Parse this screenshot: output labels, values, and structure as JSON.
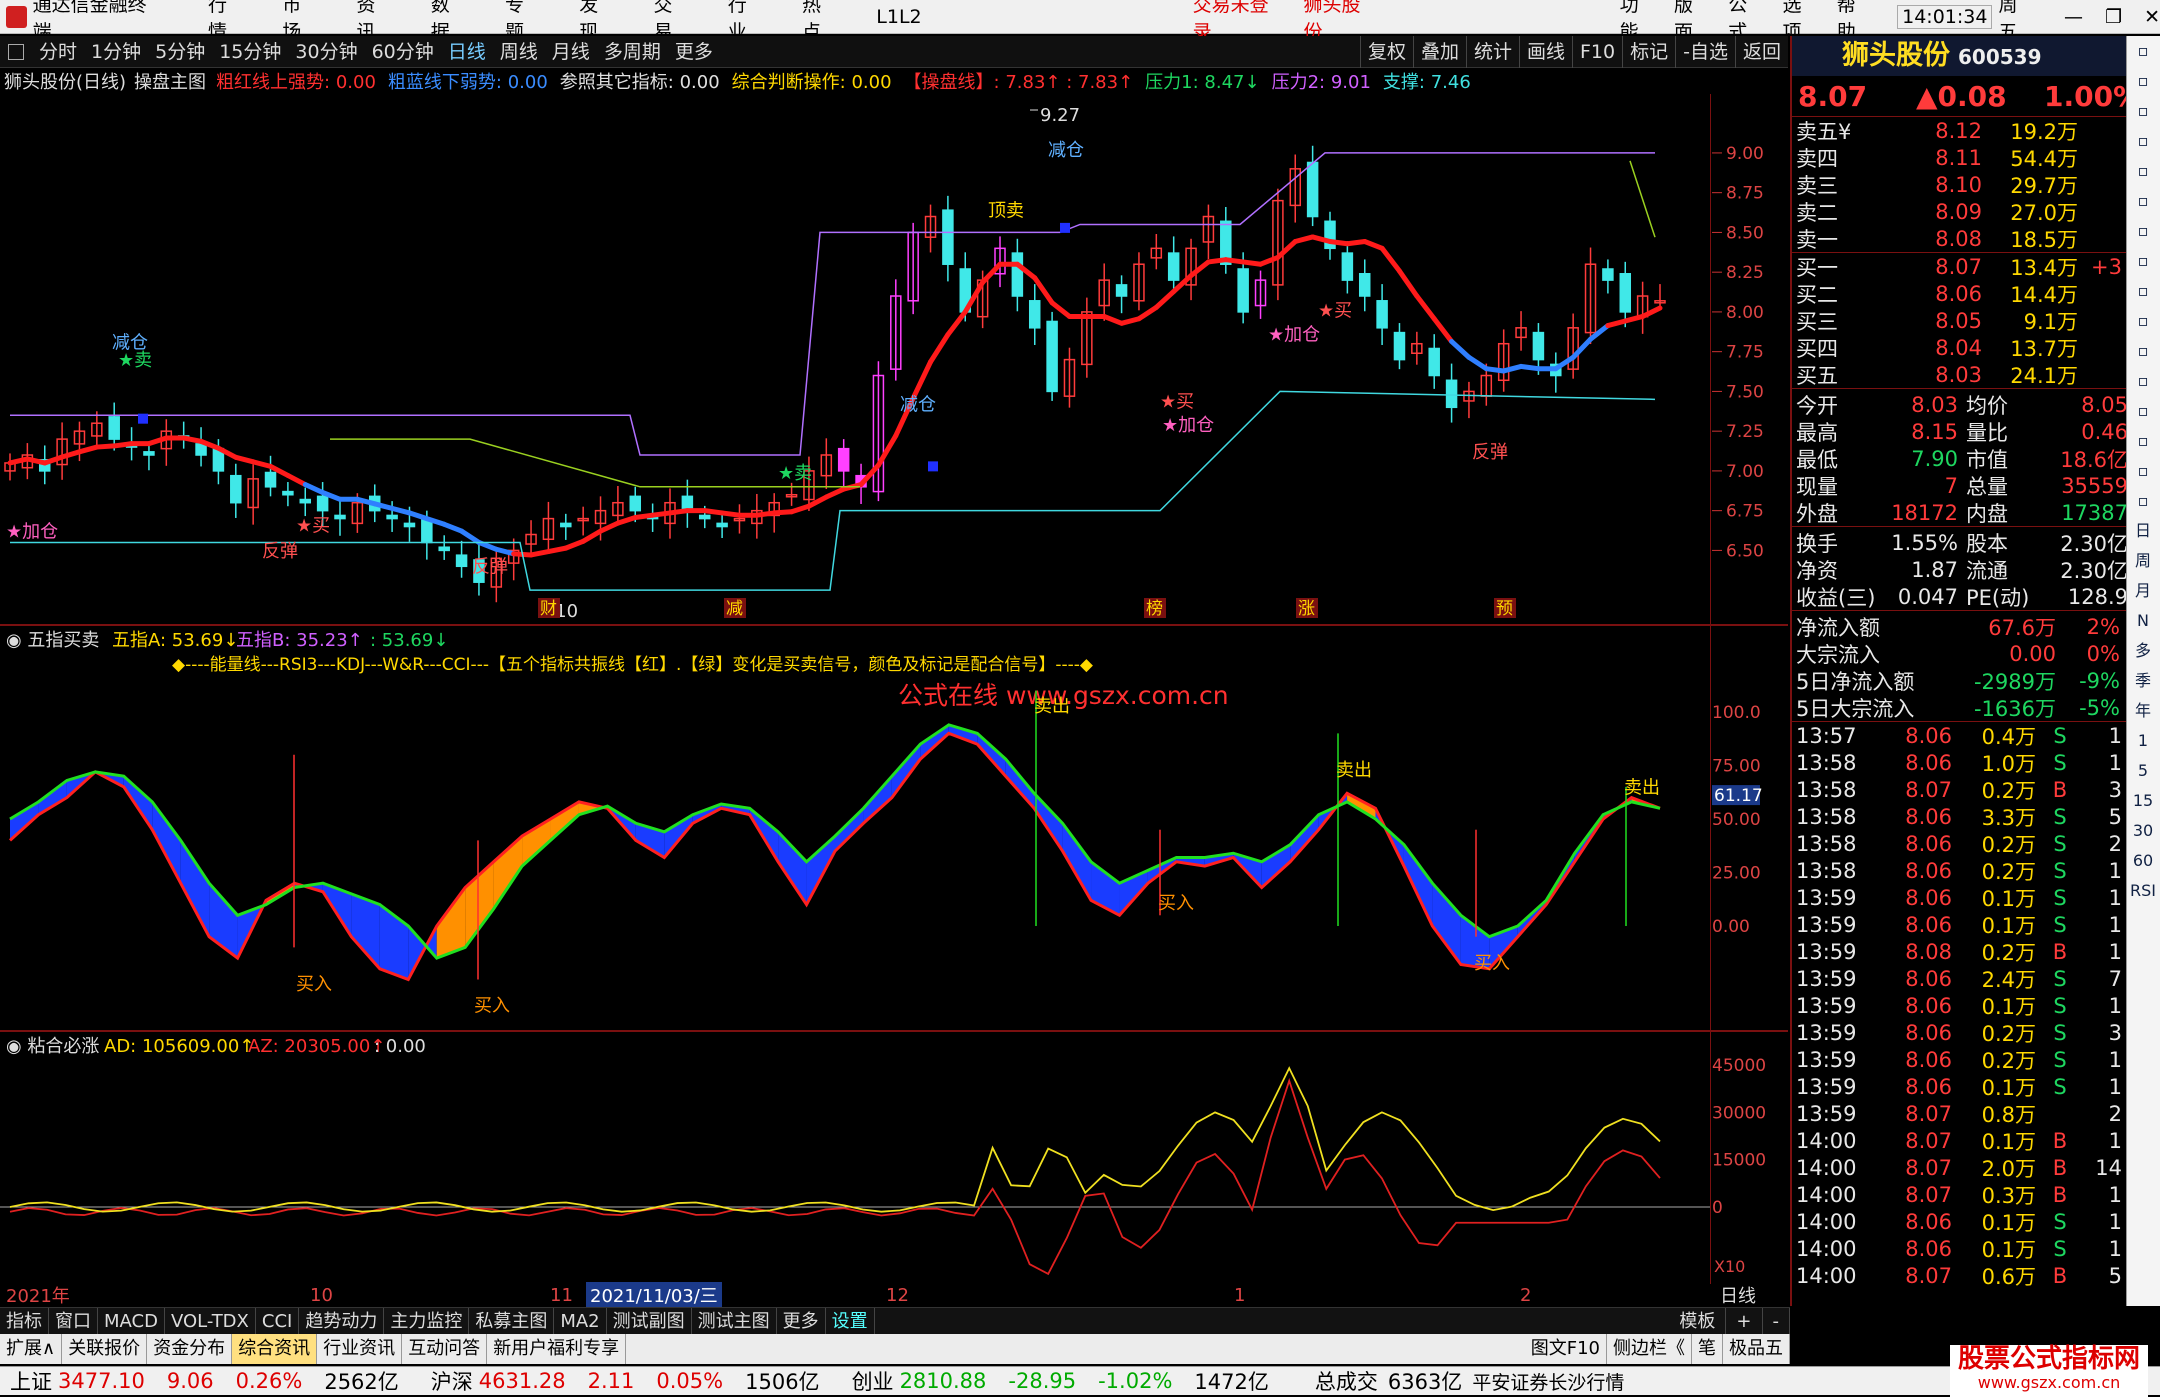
{
  "menubar": {
    "app_title": "通达信金融终端",
    "items": [
      "行情",
      "市场",
      "资讯",
      "数据",
      "专题",
      "发现",
      "交易",
      "行业",
      "热点",
      "L1L2"
    ],
    "login_status": "交易未登录",
    "stock_title": "狮头股份",
    "right_items": [
      "功能",
      "版面",
      "公式",
      "选项",
      "帮助"
    ],
    "time": "14:01:34",
    "weekday": "周五"
  },
  "toolbar": {
    "periods": [
      "分时",
      "1分钟",
      "5分钟",
      "15分钟",
      "30分钟",
      "60分钟",
      "日线",
      "周线",
      "月线",
      "多周期",
      "更多"
    ],
    "active": "日线",
    "right": [
      "复权",
      "叠加",
      "统计",
      "画线",
      "F10",
      "标记",
      "-自选",
      "返回"
    ]
  },
  "main_panel": {
    "title": "狮头股份(日线)",
    "indicator": "操盘主图",
    "items": [
      {
        "t": "粗红线上强势: 0.00",
        "c": "red"
      },
      {
        "t": "粗蓝线下弱势: 0.00",
        "c": "blue"
      },
      {
        "t": "参照其它指标: 0.00",
        "c": "wht"
      },
      {
        "t": "综合判断操作: 0.00",
        "c": "yel"
      },
      {
        "t": "【操盘线】: 7.83↑ : 7.83↑",
        "c": "red"
      },
      {
        "t": "压力1: 8.47↓",
        "c": "grn"
      },
      {
        "t": "压力2: 9.01",
        "c": "mag"
      },
      {
        "t": "支撑: 7.46",
        "c": "cyan"
      }
    ],
    "yaxis": [
      "9.00",
      "8.75",
      "8.50",
      "8.25",
      "8.00",
      "7.75",
      "7.50",
      "7.25",
      "7.00",
      "6.75",
      "6.50"
    ],
    "labels": {
      "high": "9.27",
      "low": "6.10",
      "jiancang1": "减仓",
      "jiancang2": "减仓",
      "jiancang3": "减仓",
      "dingmai": "顶卖",
      "mai": "卖",
      "maichu": "卖出",
      "jiacang": "加仓",
      "fantan": "反弹",
      "buy": "买",
      "events": [
        "财",
        "减",
        "榜",
        "涨",
        "预"
      ]
    }
  },
  "panel2": {
    "title": "五指买卖",
    "a": "五指A: 53.69↓",
    "b": "五指B: 35.23↑",
    "c": ": 53.69↓",
    "legend": "◆----能量线---RSI3---KDJ---W&R---CCI---【五个指标共振线【红】.【绿】变化是买卖信号，颜色及标记是配合信号】----◆",
    "watermark": "公式在线 www.gszx.com.cn",
    "yaxis": [
      "100.0",
      "75.00",
      "50.00",
      "25.00",
      "0.00"
    ],
    "current": "61.17",
    "buy": "买入",
    "sell": "卖出"
  },
  "panel3": {
    "title": "粘合必涨",
    "ad": "AD: 105609.00↑",
    "az": "AZ: 20305.00↑",
    "c": ": 0.00",
    "yaxis": [
      "45000",
      "30000",
      "15000",
      "0"
    ],
    "x10": "X10"
  },
  "xaxis": {
    "labels": [
      "2021年",
      "10",
      "11",
      "2021/11/03/三",
      "12",
      "1",
      "2"
    ],
    "mode": "日线"
  },
  "tabs1": [
    "指标",
    "窗口",
    "MACD",
    "VOL-TDX",
    "CCI",
    "趋势动力",
    "主力监控",
    "私募主图",
    "MA2",
    "测试副图",
    "测试主图",
    "更多",
    "设置"
  ],
  "tabs1_right": [
    "模板",
    "+",
    "-"
  ],
  "tabs2": [
    "扩展∧",
    "关联报价",
    "资金分布",
    "综合资讯",
    "行业资讯",
    "互动问答",
    "新用户福利专享"
  ],
  "tabs2_right": [
    "图文F10",
    "侧边栏《",
    "笔",
    "极品五"
  ],
  "quote": {
    "name": "狮头股份",
    "code": "600539",
    "price": "8.07",
    "change": "▲0.08",
    "pct": "1.00%",
    "asks": [
      [
        "卖五¥",
        "8.12",
        "19.2万"
      ],
      [
        "卖四",
        "8.11",
        "54.4万"
      ],
      [
        "卖三",
        "8.10",
        "29.7万"
      ],
      [
        "卖二",
        "8.09",
        "27.0万"
      ],
      [
        "卖一",
        "8.08",
        "18.5万"
      ]
    ],
    "bids": [
      [
        "买一",
        "8.07",
        "13.4万",
        "+3"
      ],
      [
        "买二",
        "8.06",
        "14.4万",
        ""
      ],
      [
        "买三",
        "8.05",
        "9.1万",
        ""
      ],
      [
        "买四",
        "8.04",
        "13.7万",
        ""
      ],
      [
        "买五",
        "8.03",
        "24.1万",
        ""
      ]
    ],
    "stats": [
      [
        "今开",
        "8.03",
        "均价",
        "8.05"
      ],
      [
        "最高",
        "8.15",
        "量比",
        "0.46"
      ],
      [
        "最低",
        "7.90",
        "市值",
        "18.6亿"
      ],
      [
        "现量",
        "7",
        "总量",
        "35559"
      ],
      [
        "外盘",
        "18172",
        "内盘",
        "17387"
      ]
    ],
    "stats2": [
      [
        "换手",
        "1.55%",
        "股本",
        "2.30亿"
      ],
      [
        "净资",
        "1.87",
        "流通",
        "2.30亿"
      ],
      [
        "收益(三)",
        "0.047",
        "PE(动)",
        "128.9"
      ]
    ],
    "flows": [
      [
        "净流入额",
        "67.6万",
        "2%"
      ],
      [
        "大宗流入",
        "0.00",
        "0%"
      ],
      [
        "5日净流入额",
        "-2989万",
        "-9%"
      ],
      [
        "5日大宗流入",
        "-1636万",
        "-5%"
      ]
    ],
    "ticks": [
      [
        "13:57",
        "8.06",
        "0.4万",
        "S",
        "1"
      ],
      [
        "13:58",
        "8.06",
        "1.0万",
        "S",
        "1"
      ],
      [
        "13:58",
        "8.07",
        "0.2万",
        "B",
        "3"
      ],
      [
        "13:58",
        "8.06",
        "3.3万",
        "S",
        "5"
      ],
      [
        "13:58",
        "8.06",
        "0.2万",
        "S",
        "2"
      ],
      [
        "13:58",
        "8.06",
        "0.2万",
        "S",
        "1"
      ],
      [
        "13:59",
        "8.06",
        "0.1万",
        "S",
        "1"
      ],
      [
        "13:59",
        "8.06",
        "0.1万",
        "S",
        "1"
      ],
      [
        "13:59",
        "8.08",
        "0.2万",
        "B",
        "1"
      ],
      [
        "13:59",
        "8.06",
        "2.4万",
        "S",
        "7"
      ],
      [
        "13:59",
        "8.06",
        "0.1万",
        "S",
        "1"
      ],
      [
        "13:59",
        "8.06",
        "0.2万",
        "S",
        "3"
      ],
      [
        "13:59",
        "8.06",
        "0.2万",
        "S",
        "1"
      ],
      [
        "13:59",
        "8.06",
        "0.1万",
        "S",
        "1"
      ],
      [
        "13:59",
        "8.07",
        "0.8万",
        "",
        "2"
      ],
      [
        "14:00",
        "8.07",
        "0.1万",
        "B",
        "1"
      ],
      [
        "14:00",
        "8.07",
        "2.0万",
        "B",
        "14"
      ],
      [
        "14:00",
        "8.07",
        "0.3万",
        "B",
        "1"
      ],
      [
        "14:00",
        "8.06",
        "0.1万",
        "S",
        "1"
      ],
      [
        "14:00",
        "8.06",
        "0.1万",
        "S",
        "1"
      ],
      [
        "14:00",
        "8.07",
        "0.6万",
        "B",
        "5"
      ]
    ]
  },
  "statusbar": [
    {
      "k": "上证",
      "v": "3477.10",
      "c": "9.06",
      "p": "0.26%",
      "a": "2562亿"
    },
    {
      "k": "沪深",
      "v": "4631.28",
      "c": "2.11",
      "p": "0.05%",
      "a": "1506亿"
    },
    {
      "k": "创业",
      "v": "2810.88",
      "c": "-28.95",
      "p": "-1.02%",
      "a": "1472亿"
    }
  ],
  "status_total": "总成交",
  "status_total_v": "6363亿",
  "status_broker": "平安证券长沙行情",
  "brand": "股票公式指标网",
  "brand_url": "www.gszx.com.cn",
  "rightbar": [
    "日",
    "周",
    "月",
    "N",
    "多",
    "季",
    "年",
    "1",
    "5",
    "15",
    "30",
    "60",
    "RSI"
  ],
  "chart_data": {
    "type": "candlestick",
    "ylim": [
      6.1,
      9.27
    ],
    "closes": [
      7.05,
      7.1,
      7.0,
      7.2,
      7.25,
      7.3,
      7.2,
      7.15,
      7.1,
      7.25,
      7.2,
      7.1,
      7.0,
      6.8,
      6.95,
      6.9,
      6.85,
      6.8,
      6.75,
      6.7,
      6.8,
      6.75,
      6.7,
      6.65,
      6.55,
      6.5,
      6.4,
      6.3,
      6.45,
      6.5,
      6.6,
      6.7,
      6.65,
      6.7,
      6.75,
      6.8,
      6.75,
      6.7,
      6.8,
      6.75,
      6.7,
      6.65,
      6.7,
      6.75,
      6.8,
      6.85,
      7.0,
      7.1,
      7.0,
      6.9,
      7.6,
      8.1,
      8.5,
      8.6,
      8.3,
      8.0,
      8.2,
      8.4,
      8.1,
      7.9,
      7.5,
      7.7,
      8.0,
      8.2,
      8.1,
      8.3,
      8.4,
      8.2,
      8.4,
      8.6,
      8.3,
      8.0,
      8.2,
      8.7,
      8.9,
      8.6,
      8.4,
      8.2,
      8.1,
      7.9,
      7.7,
      7.8,
      7.6,
      7.4,
      7.5,
      7.6,
      7.8,
      7.9,
      7.7,
      7.6,
      7.9,
      8.3,
      8.2,
      8.0,
      8.1,
      8.07
    ]
  }
}
